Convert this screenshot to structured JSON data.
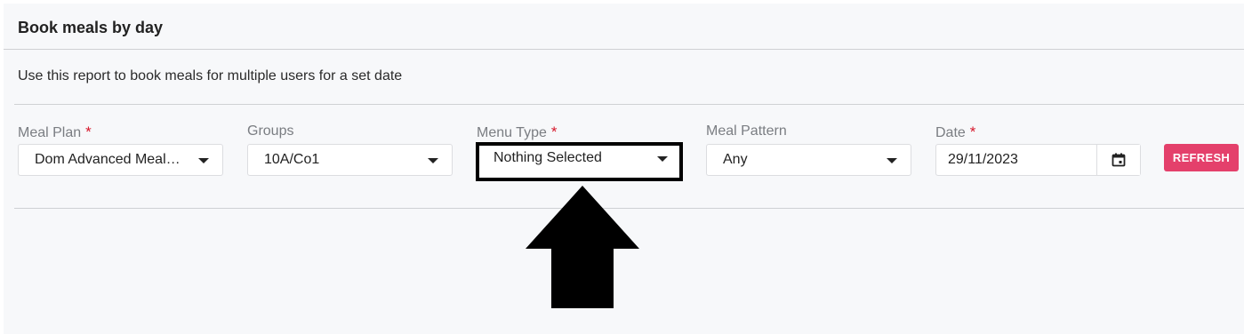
{
  "page": {
    "title": "Book meals by day",
    "description": "Use this report to book meals for multiple users for a set date"
  },
  "filters": {
    "meal_plan": {
      "label": "Meal Plan",
      "required": "*",
      "value": "Dom Advanced Meal…"
    },
    "groups": {
      "label": "Groups",
      "value": "10A/Co1"
    },
    "menu_type": {
      "label": "Menu Type",
      "required": "*",
      "value": "Nothing Selected"
    },
    "meal_pattern": {
      "label": "Meal Pattern",
      "value": "Any"
    },
    "date": {
      "label": "Date",
      "required": "*",
      "value": "29/11/2023"
    }
  },
  "actions": {
    "refresh_label": "REFRESH"
  },
  "icons": {
    "dropdown": "caret-down-icon",
    "calendar": "calendar-icon",
    "pointer": "arrow-up-icon"
  },
  "colors": {
    "accent": "#e4406b",
    "required": "#d6182b",
    "annotation": "#000000"
  }
}
